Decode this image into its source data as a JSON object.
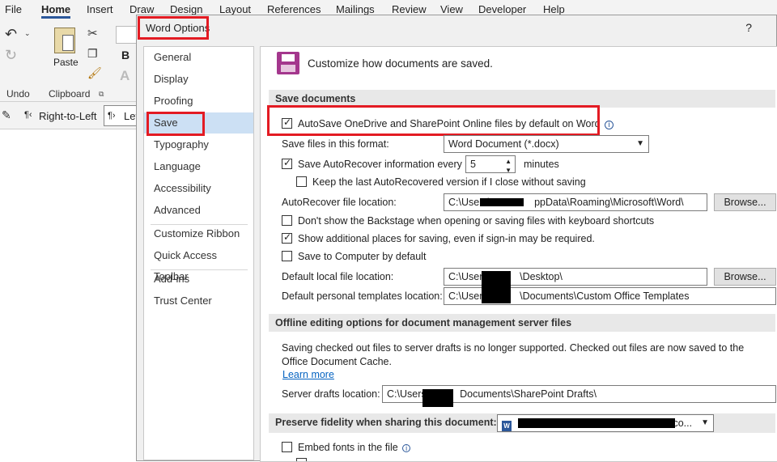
{
  "ribbon": {
    "tabs": [
      "File",
      "Home",
      "Insert",
      "Draw",
      "Design",
      "Layout",
      "References",
      "Mailings",
      "Review",
      "View",
      "Developer",
      "Help"
    ],
    "paste_label": "Paste",
    "undo_group": "Undo",
    "clipboard_group": "Clipboard",
    "bold_label": "B",
    "rtl_label": "Right-to-Left",
    "ltr_label": "Lef"
  },
  "dialog": {
    "title": "Word Options",
    "help": "?",
    "nav": [
      "General",
      "Display",
      "Proofing",
      "Save",
      "Typography",
      "Language",
      "Accessibility",
      "Advanced",
      "Customize Ribbon",
      "Quick Access Toolbar",
      "Add-ins",
      "Trust Center"
    ],
    "selected_nav": "Save",
    "header": "Customize how documents are saved.",
    "save_documents": {
      "heading": "Save documents",
      "autosave": "AutoSave OneDrive and SharePoint Online files by default on Word",
      "format_label": "Save files in this format:",
      "format_value": "Word Document (*.docx)",
      "autorecover_label": "Save AutoRecover information every",
      "autorecover_value": "5",
      "minutes": "minutes",
      "keep_last": "Keep the last AutoRecovered version if I close without saving",
      "ar_location_label": "AutoRecover file location:",
      "ar_location_prefix": "C:\\Users\\",
      "ar_location_suffix": "ppData\\Roaming\\Microsoft\\Word\\",
      "browse": "Browse...",
      "no_backstage": "Don't show the Backstage when opening or saving files with keyboard shortcuts",
      "show_places": "Show additional places for saving, even if sign-in may be required.",
      "save_computer": "Save to Computer by default",
      "local_label": "Default local file location:",
      "local_prefix": "C:\\Users\\",
      "local_suffix": "\\Desktop\\",
      "templates_label": "Default personal templates location:",
      "templates_prefix": "C:\\Users\\",
      "templates_suffix": "\\Documents\\Custom Office Templates"
    },
    "offline": {
      "heading": "Offline editing options for document management server files",
      "note": "Saving checked out files to server drafts is no longer supported. Checked out files are now saved to the Office Document Cache.",
      "learn_more": "Learn more",
      "drafts_label": "Server drafts location:",
      "drafts_prefix": "C:\\Users\\",
      "drafts_suffix": "Documents\\SharePoint Drafts\\"
    },
    "fidelity": {
      "heading": "Preserve fidelity when sharing this document:",
      "doc_suffix": "co...",
      "embed_fonts": "Embed fonts in the file"
    }
  },
  "colors": {
    "highlight": "#e31b23",
    "selected_nav": "#cce0f4",
    "accent": "#2b579a"
  }
}
